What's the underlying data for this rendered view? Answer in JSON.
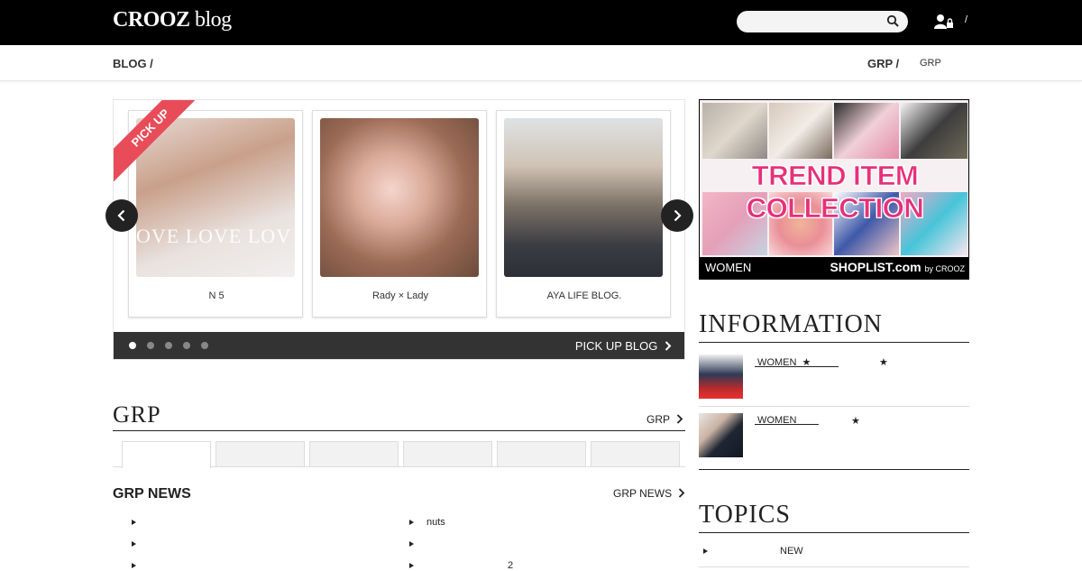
{
  "header": {
    "logo_brand": "CROOZ",
    "logo_suffix": " blog",
    "search_placeholder": "",
    "top_separator": "/"
  },
  "breadcrumb": {
    "left": "BLOG /",
    "right_main": "GRP /",
    "right_sub": "GRP"
  },
  "pickup": {
    "ribbon": "PICK UP",
    "cards": [
      {
        "label": "N 5",
        "image_overlay_text": "OVE LOVE LOV"
      },
      {
        "label": "Rady × Lady"
      },
      {
        "label": "AYA LIFE BLOG."
      }
    ],
    "dot_count": 5,
    "active_dot": 0,
    "link_label": "PICK UP BLOG"
  },
  "grp": {
    "title": "GRP",
    "link_label": "GRP",
    "tab_count": 6,
    "news_title": "GRP NEWS",
    "news_link": "GRP NEWS",
    "news_left": [
      "",
      "",
      ""
    ],
    "news_right": [
      "nuts",
      "",
      "2"
    ]
  },
  "ad": {
    "title": "TREND ITEM COLLECTION",
    "women": "WOMEN",
    "brand": "SHOPLIST.com",
    "brand_by": "by CROOZ"
  },
  "information": {
    "title": "INFORMATION",
    "items": [
      {
        "text": " WOMEN  ★          ",
        "star": "★"
      },
      {
        "text": " WOMEN        ",
        "star": "★"
      }
    ]
  },
  "topics": {
    "title": "TOPICS",
    "items": [
      {
        "text": "NEW"
      }
    ]
  }
}
